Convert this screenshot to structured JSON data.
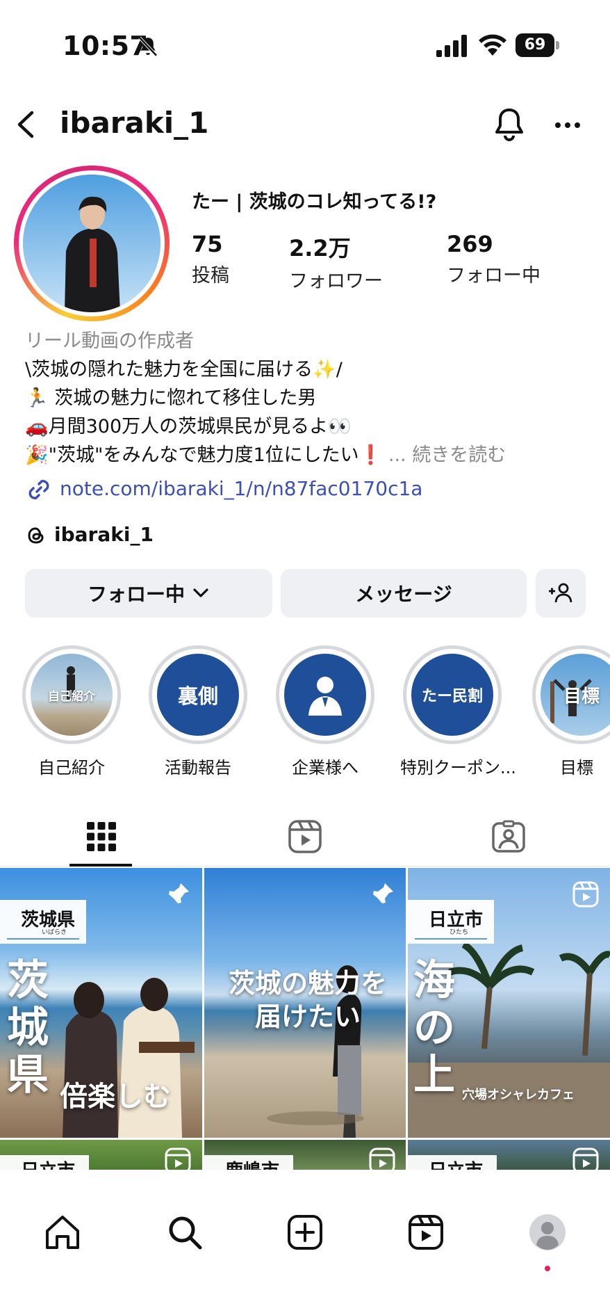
{
  "status_bar": {
    "time": "10:57",
    "battery": "69"
  },
  "header": {
    "username": "ibaraki_1"
  },
  "profile": {
    "display_name": "たー | 茨城のコレ知ってる!?",
    "stats": [
      {
        "value": "75",
        "label": "投稿"
      },
      {
        "value": "2.2万",
        "label": "フォロワー"
      },
      {
        "value": "269",
        "label": "フォロー中"
      }
    ],
    "bio": {
      "category": "リール動画の作成者",
      "lines": [
        "\\茨城の隠れた魅力を全国に届ける✨/",
        "🏃 茨城の魅力に惚れて移住した男",
        "🚗月間300万人の茨城県民が見るよ👀",
        "🎉\"茨城\"をみんなで魅力度1位にしたい❗"
      ],
      "more": "... 続きを読む"
    },
    "link": "note.com/ibaraki_1/n/n87fac0170c1a",
    "threads_handle": "ibaraki_1"
  },
  "actions": {
    "following_label": "フォロー中",
    "message_label": "メッセージ"
  },
  "highlights": [
    {
      "label": "自己紹介",
      "cover_text": "自己紹介"
    },
    {
      "label": "活動報告",
      "cover_text": "裏側"
    },
    {
      "label": "企業様へ",
      "cover_text": ""
    },
    {
      "label": "特別クーポン...",
      "cover_text": "たー民割"
    },
    {
      "label": "目標",
      "cover_text": "目標"
    }
  ],
  "tabs": [
    "grid-tab",
    "reels-tab",
    "tagged-tab"
  ],
  "posts": [
    {
      "area": "茨城県",
      "area_reading": "いばらき",
      "big_text": "茨城県",
      "sub_text": "倍楽しむ",
      "pinned": true
    },
    {
      "area": "",
      "area_reading": "",
      "big_text": "茨城の魅力を",
      "sub_text": "届けたい",
      "pinned": true
    },
    {
      "area": "日立市",
      "area_reading": "ひたち",
      "big_text": "海の上",
      "sub_text": "穴場オシャレカフェ",
      "pinned": false
    },
    {
      "area": "日立市",
      "area_reading": "",
      "big_text": "",
      "sub_text": "",
      "pinned": false
    },
    {
      "area": "鹿嶋市",
      "area_reading": "",
      "big_text": "",
      "sub_text": "",
      "pinned": false
    },
    {
      "area": "日立市",
      "area_reading": "",
      "big_text": "",
      "sub_text": "",
      "pinned": false
    }
  ],
  "colors": {
    "button_bg": "#eff0f3",
    "link": "#3b4fb5",
    "highlight_blue": "#1f4f99",
    "notification_dot": "#e0245e"
  }
}
